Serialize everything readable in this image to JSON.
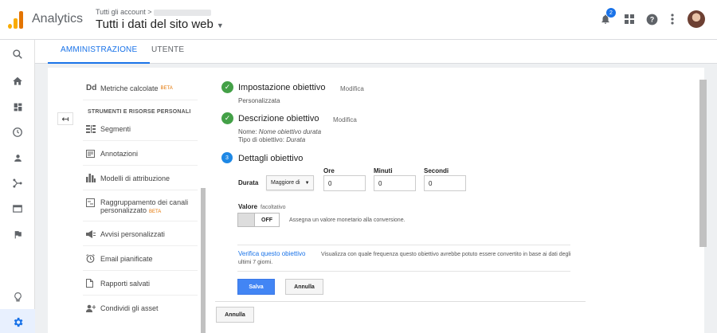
{
  "header": {
    "brand": "Analytics",
    "account_crumb": "Tutti gli account >",
    "account_title": "Tutti i dati del sito web",
    "notifications_count": "2"
  },
  "tabs": [
    {
      "label": "AMMINISTRAZIONE",
      "active": true
    },
    {
      "label": "UTENTE",
      "active": false
    }
  ],
  "sidebar": {
    "top_item": {
      "icon": "Dd",
      "label": "Metriche calcolate",
      "badge": "BETA"
    },
    "section_title": "STRUMENTI E RISORSE PERSONALI",
    "items": [
      {
        "label": "Segmenti",
        "icon": "segments-icon"
      },
      {
        "label": "Annotazioni",
        "icon": "annotations-icon"
      },
      {
        "label": "Modelli di attribuzione",
        "icon": "bar-chart-icon"
      },
      {
        "label": "Raggruppamento dei canali",
        "label2": "personalizzato",
        "badge": "BETA",
        "icon": "grouping-icon"
      },
      {
        "label": "Avvisi personalizzati",
        "icon": "megaphone-icon"
      },
      {
        "label": "Email pianificate",
        "icon": "alarm-icon"
      },
      {
        "label": "Rapporti salvati",
        "icon": "document-icon"
      },
      {
        "label": "Condividi gli asset",
        "icon": "share-user-icon"
      }
    ]
  },
  "goal": {
    "step1": {
      "title": "Impostazione obiettivo",
      "edit": "Modifica",
      "summary": "Personalizzata"
    },
    "step2": {
      "title": "Descrizione obiettivo",
      "edit": "Modifica",
      "name_label": "Nome:",
      "name_value": "Nome obiettivo durata",
      "type_label": "Tipo di obiettivo:",
      "type_value": "Durata"
    },
    "step3": {
      "number": "3",
      "title": "Dettagli obiettivo"
    },
    "duration": {
      "label": "Durata",
      "comparison": "Maggiore di",
      "hours_label": "Ore",
      "hours": "0",
      "minutes_label": "Minuti",
      "minutes": "0",
      "seconds_label": "Secondi",
      "seconds": "0"
    },
    "value": {
      "label": "Valore",
      "optional": "facoltativo",
      "toggle": "OFF",
      "description": "Assegna un valore monetario alla conversione."
    },
    "verify": {
      "link": "Verifica questo obiettivo",
      "description": "Visualizza con quale frequenza questo obiettivo avrebbe potuto essere convertito in base ai dati degli ultimi 7 giorni."
    },
    "save": "Salva",
    "cancel": "Annulla"
  },
  "footer": {
    "cancel": "Annulla"
  },
  "colors": {
    "accent": "#1a73e8",
    "success": "#43a047",
    "save_button": "#4285f4",
    "beta": "#e37400"
  }
}
